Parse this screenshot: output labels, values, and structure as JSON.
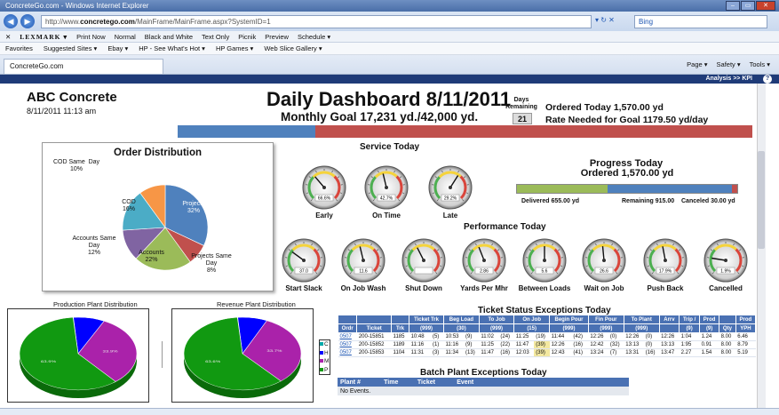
{
  "browser": {
    "title": "ConcreteGo.com - Windows Internet Explorer",
    "url_prefix": "http://www.",
    "url_domain": "concretego.com",
    "url_rest": "/MainFrame/MainFrame.aspx?SystemID=1",
    "search_placeholder": "Bing",
    "back_glyph": "◀",
    "forward_glyph": "▶",
    "url_icons": "▾ ↻ ✕",
    "tab_label": "ConcreteGo.com",
    "window_buttons": [
      "–",
      "▭",
      "✕"
    ],
    "cmd_items": [
      "Page ▾",
      "Safety ▾",
      "Tools ▾"
    ],
    "toolbar_items": [
      "Print Now",
      "Normal",
      "Black and White",
      "Text Only",
      "Picnik",
      "Preview",
      "Schedule ▾"
    ],
    "toolbar_brand": "LEXMARK ▾",
    "toolbar_close": "✕",
    "favorites": [
      "Favorites",
      "Suggested Sites ▾",
      "Ebay ▾",
      "HP - See What's Hot ▾",
      "HP Games ▾",
      "Web Slice Gallery ▾"
    ],
    "appbar_text": "Analysis >> KPI",
    "help": "?"
  },
  "header": {
    "company": "ABC Concrete",
    "datetime": "8/11/2011 11:13 am",
    "title": "Daily Dashboard 8/11/2011",
    "goal": "Monthly Goal 17,231 yd./42,000 yd.",
    "days_label": "Days Remaining",
    "days_value": "21",
    "ordered_today": "Ordered Today 1,570.00 yd",
    "rate_needed": "Rate Needed for Goal  1179.50 yd/day",
    "goal_progress": 0.41
  },
  "order_distribution": {
    "title": "Order Distribution",
    "labels": {
      "projects": "Projects\n32%",
      "projects_same_day": "Projects Same\nDay\n8%",
      "accounts": "Accounts\n22%",
      "accounts_same_day": "Accounts Same\nDay\n12%",
      "cod": "COD\n16%",
      "cod_same_day": "COD Same  Day\n10%"
    },
    "chart_data": {
      "type": "pie",
      "title": "Order Distribution",
      "categories": [
        "Projects",
        "Projects Same Day",
        "Accounts",
        "Accounts Same Day",
        "COD",
        "COD Same Day"
      ],
      "values": [
        32,
        8,
        22,
        12,
        16,
        10
      ],
      "colors": [
        "#4f81bd",
        "#c0504d",
        "#9bbb59",
        "#8064a2",
        "#4bacc6",
        "#f79646"
      ]
    }
  },
  "service": {
    "title": "Service Today",
    "gauges": [
      {
        "label": "Early",
        "value_text": "66.6%",
        "value": 0.35
      },
      {
        "label": "On Time",
        "value_text": "42.7%",
        "value": 0.45
      },
      {
        "label": "Late",
        "value_text": "29.2%",
        "value": 0.62
      }
    ]
  },
  "progress": {
    "title": "Progress Today",
    "ordered": "Ordered 1,570.00 yd",
    "delivered": "Delivered 655.00 yd",
    "remaining": "Remaining 915.00",
    "canceled": "Canceled 30.00 yd",
    "delivered_frac": 0.417,
    "remaining_frac": 0.583,
    "canceled_frac": 0.019
  },
  "performance": {
    "title": "Performance Today",
    "gauges": [
      {
        "label": "Start Slack",
        "value_text": "37.0",
        "value": 0.3
      },
      {
        "label": "On Job Wash",
        "value_text": "11.6",
        "value": 0.45
      },
      {
        "label": "Shut Down",
        "value_text": "",
        "value": 0.4
      },
      {
        "label": "Yards Per Mhr",
        "value_text": "2.86",
        "value": 0.42
      },
      {
        "label": "Between Loads",
        "value_text": "5.6",
        "value": 0.5
      },
      {
        "label": "Wait on Job",
        "value_text": "26.6",
        "value": 0.48
      },
      {
        "label": "Push Back",
        "value_text": "17.9%",
        "value": 0.46
      },
      {
        "label": "Cancelled",
        "value_text": "1.9%",
        "value": 0.2
      }
    ]
  },
  "plants": {
    "production_title": "Production Plant Distribution",
    "revenue_title": "Revenue Plant Distribution",
    "legend": [
      "C",
      "H",
      "M",
      "P"
    ],
    "production_chart": {
      "type": "pie",
      "categories": [
        "C",
        "H",
        "M",
        "P"
      ],
      "values": [
        0.1,
        9.2,
        33.9,
        63.9
      ],
      "labels": [
        "",
        "",
        "33.9%",
        "63.9%"
      ],
      "colors": [
        "#00a8a8",
        "#0000ff",
        "#aa22aa",
        "#119911"
      ]
    },
    "revenue_chart": {
      "type": "pie",
      "categories": [
        "C",
        "H",
        "M",
        "P"
      ],
      "values": [
        0.1,
        8.6,
        33.7,
        63.6
      ],
      "labels": [
        "",
        "",
        "33.7%",
        "63.6%"
      ],
      "colors": [
        "#00a8a8",
        "#0000ff",
        "#aa22aa",
        "#119911"
      ]
    }
  },
  "ticket_status": {
    "title": "Ticket Status Exceptions Today",
    "header_top": [
      "",
      "",
      "",
      "Ticket Trk",
      "Beg Load",
      "To Job",
      "On Job",
      "Begin Pour",
      "Fin Pour",
      "To Plant",
      "Arrv",
      "Trip /",
      "Prod",
      "",
      "Prod"
    ],
    "header_sub": [
      "Ordr",
      "Ticket",
      "Trk",
      "(999)",
      "(30)",
      "(999)",
      "(15)",
      "(999)",
      "(999)",
      "(999)",
      "",
      "(9)",
      "(9)",
      "Qty",
      "YPH"
    ],
    "rows": [
      [
        "0507",
        "200-15851",
        "1185",
        "10:48",
        "(5)",
        "10:53",
        "(9)",
        "11:02",
        "(24)",
        "11:25",
        "(19)",
        "11:44",
        "(42)",
        "12:26",
        "(0)",
        "12:26",
        "(0)",
        "12:26",
        "1:04",
        "1.24",
        "8.00",
        "6.46"
      ],
      [
        "0507",
        "200-15852",
        "1189",
        "11:16",
        "(1)",
        "11:16",
        "(9)",
        "11:25",
        "(22)",
        "11:47",
        "(39)",
        "12:26",
        "(16)",
        "12:42",
        "(32)",
        "13:13",
        "(0)",
        "13:13",
        "1:95",
        "0.91",
        "8.00",
        "8.79"
      ],
      [
        "0507",
        "200-15853",
        "1104",
        "11:31",
        "(3)",
        "11:34",
        "(13)",
        "11:47",
        "(16)",
        "12:03",
        "(39)",
        "12:43",
        "(41)",
        "13:24",
        "(7)",
        "13:31",
        "(16)",
        "13:47",
        "2.27",
        "1.54",
        "8.00",
        "5.19"
      ]
    ]
  },
  "batch_plant": {
    "title": "Batch Plant Exceptions Today",
    "headers": [
      "Plant #",
      "Time",
      "Ticket",
      "Event"
    ],
    "empty": "No Events."
  }
}
